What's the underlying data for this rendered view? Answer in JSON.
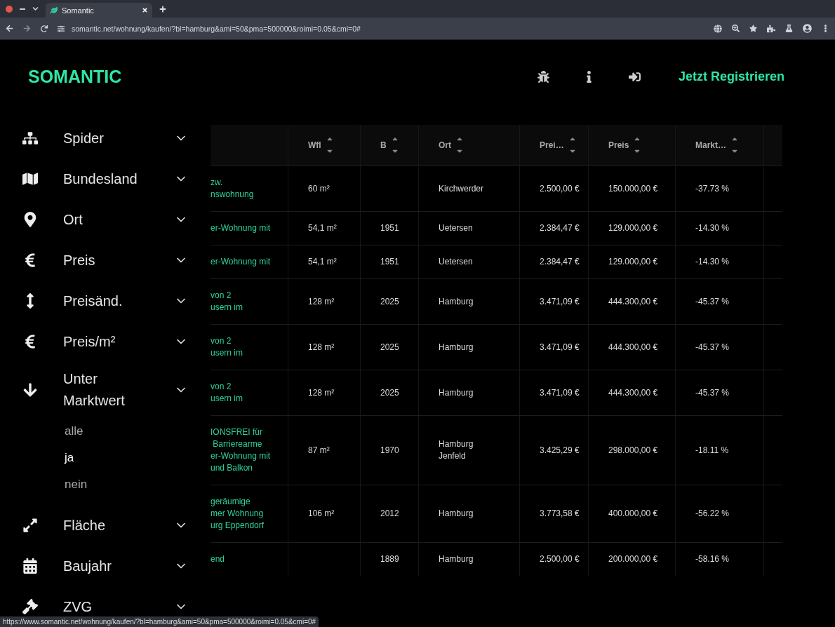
{
  "browser": {
    "tab_title": "Somantic",
    "url": "somantic.net/wohnung/kaufen/?bl=hamburg&ami=50&pma=500000&roimi=0.05&cmi=0#",
    "status_url": "https://www.somantic.net/wohnung/kaufen/?bl=hamburg&ami=50&pma=500000&roimi=0.05&cmi=0#"
  },
  "header": {
    "logo": "SOMANTIC",
    "register": "Jetzt Registrieren"
  },
  "sidebar": {
    "filters": [
      {
        "label": "Spider"
      },
      {
        "label": "Bundesland"
      },
      {
        "label": "Ort"
      },
      {
        "label": "Preis"
      },
      {
        "label": "Preisänd."
      },
      {
        "label": "Preis/m²"
      },
      {
        "label": "Unter Marktwert",
        "options": [
          {
            "label": "alle",
            "selected": false
          },
          {
            "label": "ja",
            "selected": true
          },
          {
            "label": "nein",
            "selected": false
          }
        ]
      },
      {
        "label": "Fläche"
      },
      {
        "label": "Baujahr"
      },
      {
        "label": "ZVG"
      }
    ]
  },
  "table": {
    "columns": [
      "Wfl",
      "B",
      "Ort",
      "Prei…",
      "Preis",
      "Markt…"
    ],
    "rows": [
      {
        "title": "zw.\nnswohnung",
        "cells": [
          "60 m²",
          "",
          "Kirchwerder",
          "2.500,00 €",
          "150.000,00 €",
          "-37.73 %"
        ]
      },
      {
        "title": "er-Wohnung mit",
        "cells": [
          "54,1 m²",
          "1951",
          "Uetersen",
          "2.384,47 €",
          "129.000,00 €",
          "-14.30 %"
        ]
      },
      {
        "title": "er-Wohnung mit",
        "cells": [
          "54,1 m²",
          "1951",
          "Uetersen",
          "2.384,47 €",
          "129.000,00 €",
          "-14.30 %"
        ]
      },
      {
        "title": "von 2\nusern im",
        "cells": [
          "128 m²",
          "2025",
          "Hamburg",
          "3.471,09 €",
          "444.300,00 €",
          "-45.37 %"
        ]
      },
      {
        "title": "von 2\nusern im",
        "cells": [
          "128 m²",
          "2025",
          "Hamburg",
          "3.471,09 €",
          "444.300,00 €",
          "-45.37 %"
        ]
      },
      {
        "title": "von 2\nusern im",
        "cells": [
          "128 m²",
          "2025",
          "Hamburg",
          "3.471,09 €",
          "444.300,00 €",
          "-45.37 %"
        ]
      },
      {
        "title": "IONSFREI für\n Barrierearme\ner-Wohnung mit\nund Balkon",
        "cells": [
          "87 m²",
          "1970",
          "Hamburg\nJenfeld",
          "3.425,29 €",
          "298.000,00 €",
          "-18.11 %"
        ]
      },
      {
        "title": "geräumige\nmer Wohnung\nurg Eppendorf",
        "cells": [
          "106 m²",
          "2012",
          "Hamburg",
          "3.773,58 €",
          "400.000,00 €",
          "-56.22 %"
        ]
      },
      {
        "title": "end",
        "cells": [
          "",
          "1889",
          "Hamburg",
          "2.500,00 €",
          "200.000,00 €",
          "-58.16 %"
        ]
      }
    ]
  }
}
